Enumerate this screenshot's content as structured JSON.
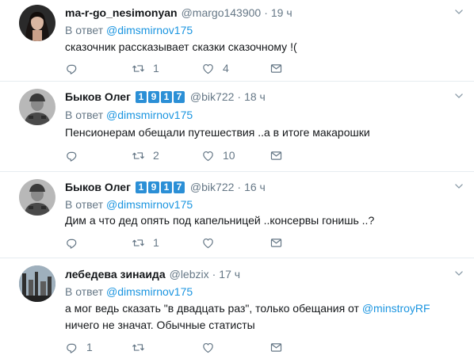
{
  "reply_prefix": "В ответ",
  "tweets": [
    {
      "name": "ma-r-go_nesimonyan",
      "handle": "@margo143900",
      "time": "19 ч",
      "badge": [],
      "reply_to": "@dimsmirnov175",
      "text": "сказочник рассказывает сказки сказочному !(",
      "replies": "",
      "retweets": "1",
      "likes": "4",
      "avatar": "avatar-woman-dark-hair"
    },
    {
      "name": "Быков Олег",
      "handle": "@bik722",
      "time": "18 ч",
      "badge": [
        "1",
        "9",
        "1",
        "7"
      ],
      "reply_to": "@dimsmirnov175",
      "text": "Пенсионерам обещали путешествия ..а в итоге макарошки",
      "replies": "",
      "retweets": "2",
      "likes": "10",
      "avatar": "avatar-soldier-bw"
    },
    {
      "name": "Быков Олег",
      "handle": "@bik722",
      "time": "16 ч",
      "badge": [
        "1",
        "9",
        "1",
        "7"
      ],
      "reply_to": "@dimsmirnov175",
      "text": "Дим а что дед опять под капельницей ..консервы гонишь ..?",
      "replies": "",
      "retweets": "1",
      "likes": "",
      "avatar": "avatar-soldier-bw"
    },
    {
      "name": "лебедева зинаида",
      "handle": "@lebzix",
      "time": "17 ч",
      "badge": [],
      "reply_to": "@dimsmirnov175",
      "text_pre": "а мог ведь сказать \"в двадцать раз\", только обещания от ",
      "text_mention": "@minstroyRF",
      "text_post": "ничего не значат. Обычные статисты",
      "replies": "1",
      "retweets": "",
      "likes": "",
      "avatar": "avatar-city-window"
    }
  ]
}
